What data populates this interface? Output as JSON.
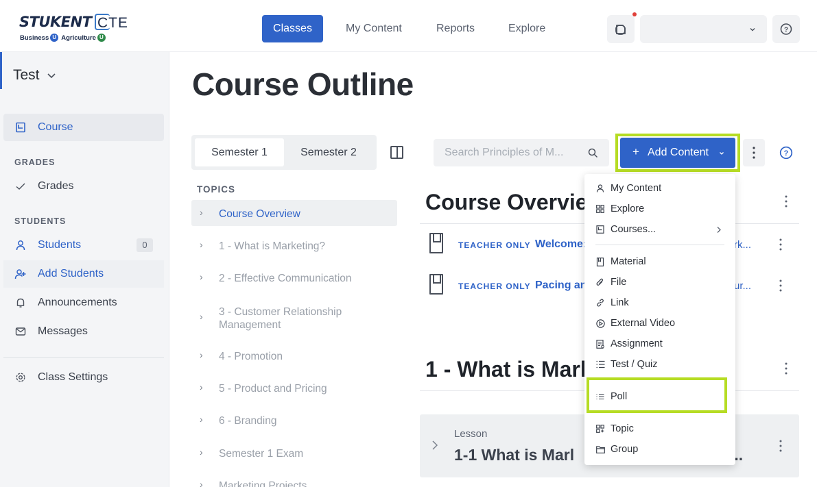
{
  "brand": {
    "name": "STUKENT",
    "suffix": "CTE",
    "sub_business": "Business",
    "sub_agriculture": "Agriculture",
    "u_letter": "U",
    "colors": {
      "primary": "#2f63c8",
      "highlight": "#b6dc24",
      "notification": "#e0403a"
    }
  },
  "nav": {
    "items": [
      {
        "label": "Classes",
        "active": true
      },
      {
        "label": "My Content",
        "active": false
      },
      {
        "label": "Reports",
        "active": false
      },
      {
        "label": "Explore",
        "active": false
      }
    ],
    "user_select_value": "",
    "help_icon": "help-circle-icon"
  },
  "sidebar": {
    "class_name": "Test",
    "course_label": "Course",
    "grades_heading": "GRADES",
    "grades_label": "Grades",
    "students_heading": "STUDENTS",
    "students_label": "Students",
    "students_count": "0",
    "add_students_label": "Add Students",
    "announcements_label": "Announcements",
    "messages_label": "Messages",
    "class_settings_label": "Class Settings"
  },
  "main": {
    "page_title": "Course Outline",
    "semester_tabs": [
      "Semester 1",
      "Semester 2"
    ],
    "topics_heading": "TOPICS",
    "topics": [
      "Course Overview",
      "1 - What is Marketing?",
      "2 - Effective Communication",
      "3 - Customer Relationship Management",
      "4 - Promotion",
      "5 - Product and Pricing",
      "6 - Branding",
      "Semester 1 Exam",
      "Marketing Projects"
    ],
    "search_placeholder": "Search Principles of M...",
    "add_content_label": "Add Content",
    "add_content_plus": "+",
    "section1_title": "Course Overview",
    "rows": [
      {
        "badge": "TEACHER ONLY",
        "title": "Welcome:",
        "tail": "rk..."
      },
      {
        "badge": "TEACHER ONLY",
        "title": "Pacing an",
        "tail": "ur..."
      }
    ],
    "section2_title": "1 - What is Marl",
    "lesson_label": "Lesson",
    "lesson_title": "1-1 What is Marl",
    "lesson_tail": "..."
  },
  "menu": {
    "group1": [
      {
        "label": "My Content",
        "icon": "user-icon"
      },
      {
        "label": "Explore",
        "icon": "grid-icon"
      },
      {
        "label": "Courses...",
        "icon": "book-icon"
      }
    ],
    "group2": [
      {
        "label": "Material",
        "icon": "document-icon"
      },
      {
        "label": "File",
        "icon": "paperclip-icon"
      },
      {
        "label": "Link",
        "icon": "link-icon"
      },
      {
        "label": "External Video",
        "icon": "play-icon"
      },
      {
        "label": "Assignment",
        "icon": "assignment-icon"
      },
      {
        "label": "Test / Quiz",
        "icon": "list-icon"
      }
    ],
    "poll": {
      "label": "Poll",
      "icon": "poll-icon"
    },
    "group3": [
      {
        "label": "Topic",
        "icon": "topic-icon"
      },
      {
        "label": "Group",
        "icon": "folder-icon"
      }
    ]
  }
}
